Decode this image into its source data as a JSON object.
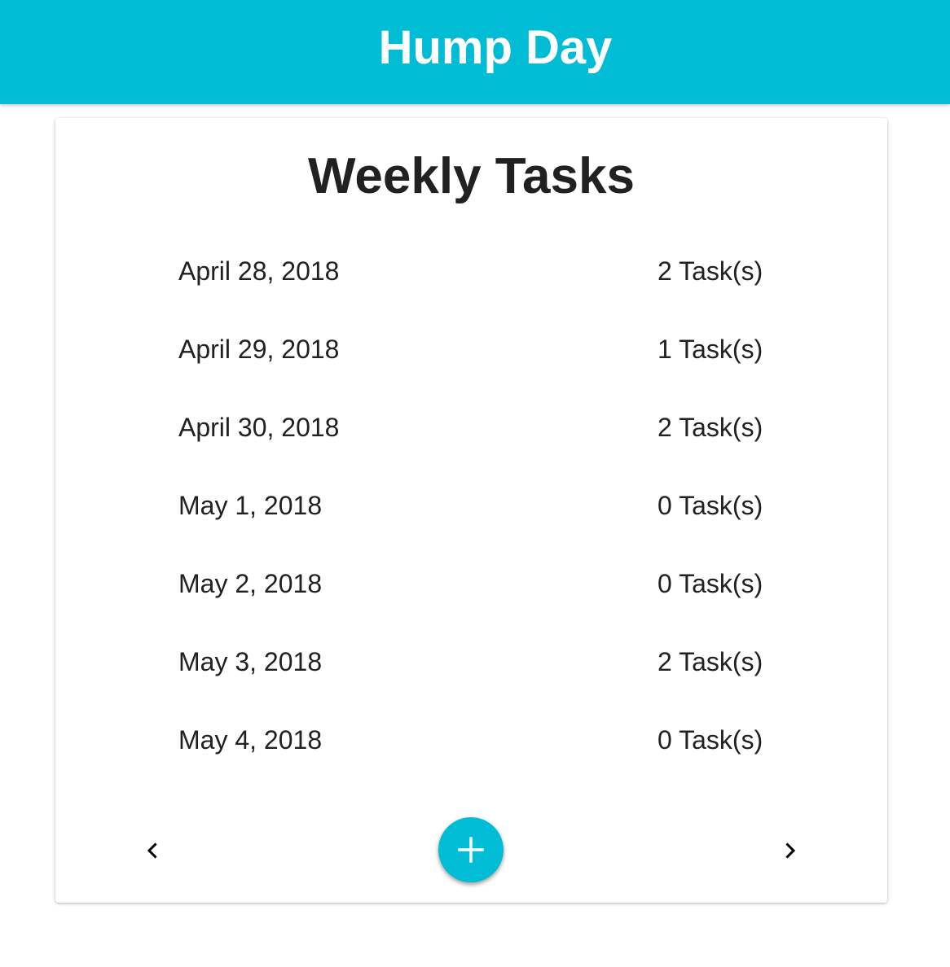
{
  "app_bar": {
    "title": "Hump Day",
    "color": "#00bcd4"
  },
  "card": {
    "title": "Weekly Tasks",
    "days": [
      {
        "date": "April 28, 2018",
        "count": "2 Task(s)"
      },
      {
        "date": "April 29, 2018",
        "count": "1 Task(s)"
      },
      {
        "date": "April 30, 2018",
        "count": "2 Task(s)"
      },
      {
        "date": "May 1, 2018",
        "count": "0 Task(s)"
      },
      {
        "date": "May 2, 2018",
        "count": "0 Task(s)"
      },
      {
        "date": "May 3, 2018",
        "count": "2 Task(s)"
      },
      {
        "date": "May 4, 2018",
        "count": "0 Task(s)"
      }
    ]
  },
  "controls": {
    "prev_icon": "chevron-left-icon",
    "next_icon": "chevron-right-icon",
    "add_icon": "plus-icon",
    "fab_color": "#00bcd4"
  }
}
